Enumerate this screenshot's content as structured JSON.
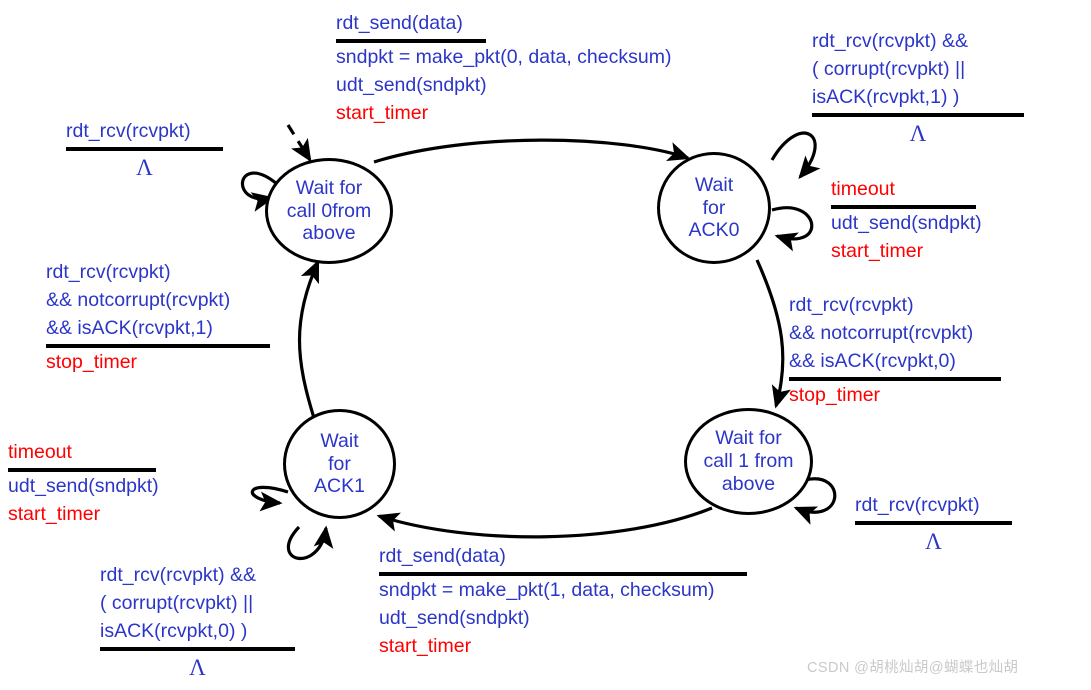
{
  "diagram": {
    "title": "rdt 3.0 sender finite state machine",
    "colors": {
      "action_blue": "#2b36c8",
      "timer_red": "#ff0000",
      "edge_black": "#000000",
      "background": "#ffffff",
      "watermark_gray": "#c9c9c9"
    }
  },
  "states": {
    "wait_call0": {
      "line1": "Wait for",
      "line2": "call 0from",
      "line3": "above"
    },
    "wait_ack0": {
      "line1": "Wait",
      "line2": "for",
      "line3": "ACK0"
    },
    "wait_call1": {
      "line1": "Wait for",
      "line2": "call 1 from",
      "line3": "above"
    },
    "wait_ack1": {
      "line1": "Wait",
      "line2": "for",
      "line3": "ACK1"
    }
  },
  "labels": {
    "rdt_send0": {
      "event": "rdt_send(data)",
      "action1": "sndpkt = make_pkt(0, data, checksum)",
      "action2": "udt_send(sndpkt)",
      "action3": "start_timer"
    },
    "rdt_send1": {
      "event": "rdt_send(data)",
      "action1": "sndpkt = make_pkt(1, data, checksum)",
      "action2": "udt_send(sndpkt)",
      "action3": "start_timer"
    },
    "ack0_corrupt": {
      "cond1": "rdt_rcv(rcvpkt) &&",
      "cond2": "( corrupt(rcvpkt) ||",
      "cond3": "isACK(rcvpkt,1) )",
      "action": "Λ"
    },
    "ack1_corrupt": {
      "cond1": "rdt_rcv(rcvpkt) &&",
      "cond2": "( corrupt(rcvpkt) ||",
      "cond3": "isACK(rcvpkt,0) )",
      "action": "Λ"
    },
    "timeout_ack0": {
      "event": "timeout",
      "action1": "udt_send(sndpkt)",
      "action2": "start_timer"
    },
    "timeout_ack1": {
      "event": "timeout",
      "action1": "udt_send(sndpkt)",
      "action2": "start_timer"
    },
    "rdt_rcv_call0": {
      "event": "rdt_rcv(rcvpkt)",
      "action": "Λ"
    },
    "rdt_rcv_call1": {
      "event": "rdt_rcv(rcvpkt)",
      "action": "Λ"
    },
    "ack1_good": {
      "cond1": "rdt_rcv(rcvpkt)",
      "cond2": "&& notcorrupt(rcvpkt)",
      "cond3": "&& isACK(rcvpkt,1)",
      "action": "stop_timer"
    },
    "ack0_good": {
      "cond1": "rdt_rcv(rcvpkt)",
      "cond2": "&& notcorrupt(rcvpkt)",
      "cond3": "&& isACK(rcvpkt,0)",
      "action": "stop_timer"
    }
  },
  "watermark": {
    "text": "CSDN @胡桃灿胡@蝴蝶也灿胡"
  }
}
